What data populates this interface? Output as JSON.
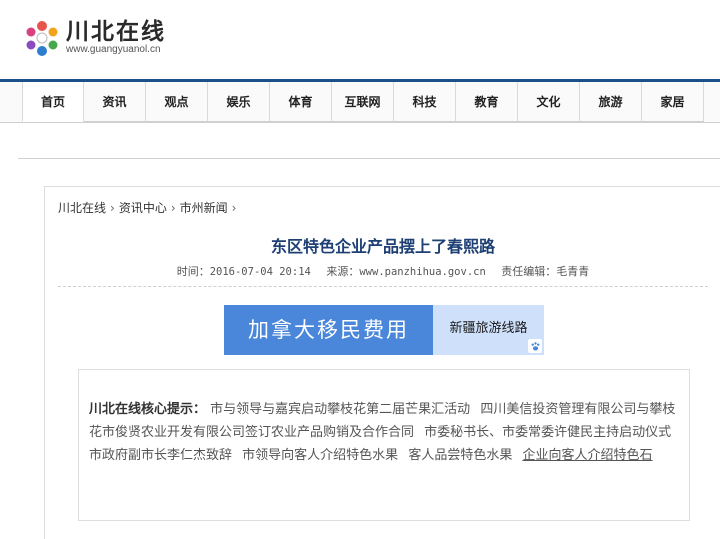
{
  "site": {
    "name": "川北在线",
    "url_text": "www.guangyuanol.cn"
  },
  "nav": {
    "items": [
      "首页",
      "资讯",
      "观点",
      "娱乐",
      "体育",
      "互联网",
      "科技",
      "教育",
      "文化",
      "旅游",
      "家居"
    ],
    "active": "首页"
  },
  "breadcrumb": [
    "川北在线",
    "资讯中心",
    "市州新闻"
  ],
  "article": {
    "title": "东区特色企业产品摆上了春熙路",
    "time_label": "时间：",
    "time": "2016-07-04 20:14",
    "source_label": "来源：",
    "source": "www.panzhihua.gov.cn",
    "editor_label": "责任编辑：",
    "editor": "毛青青"
  },
  "ad": {
    "left_text": "加拿大移民费用",
    "right_text": "新疆旅游线路"
  },
  "summary": {
    "lead": "川北在线核心提示：",
    "items": [
      "市与领导与嘉宾启动攀枝花第二届芒果汇活动",
      "四川美信投资管理有限公司与攀枝花市俊贤农业开发有限公司签订农业产品购销及合作合同",
      "市委秘书长、市委常委许健民主持启动仪式",
      "市政府副市长李仁杰致辞",
      "市领导向客人介绍特色水果",
      "客人品尝特色水果",
      "企业向客人介绍特色石"
    ]
  },
  "colors": {
    "nav_accent": "#1b4f8a",
    "title": "#1d3f73",
    "ad_left": "#4a86d9",
    "ad_right": "#cfe0fb"
  }
}
